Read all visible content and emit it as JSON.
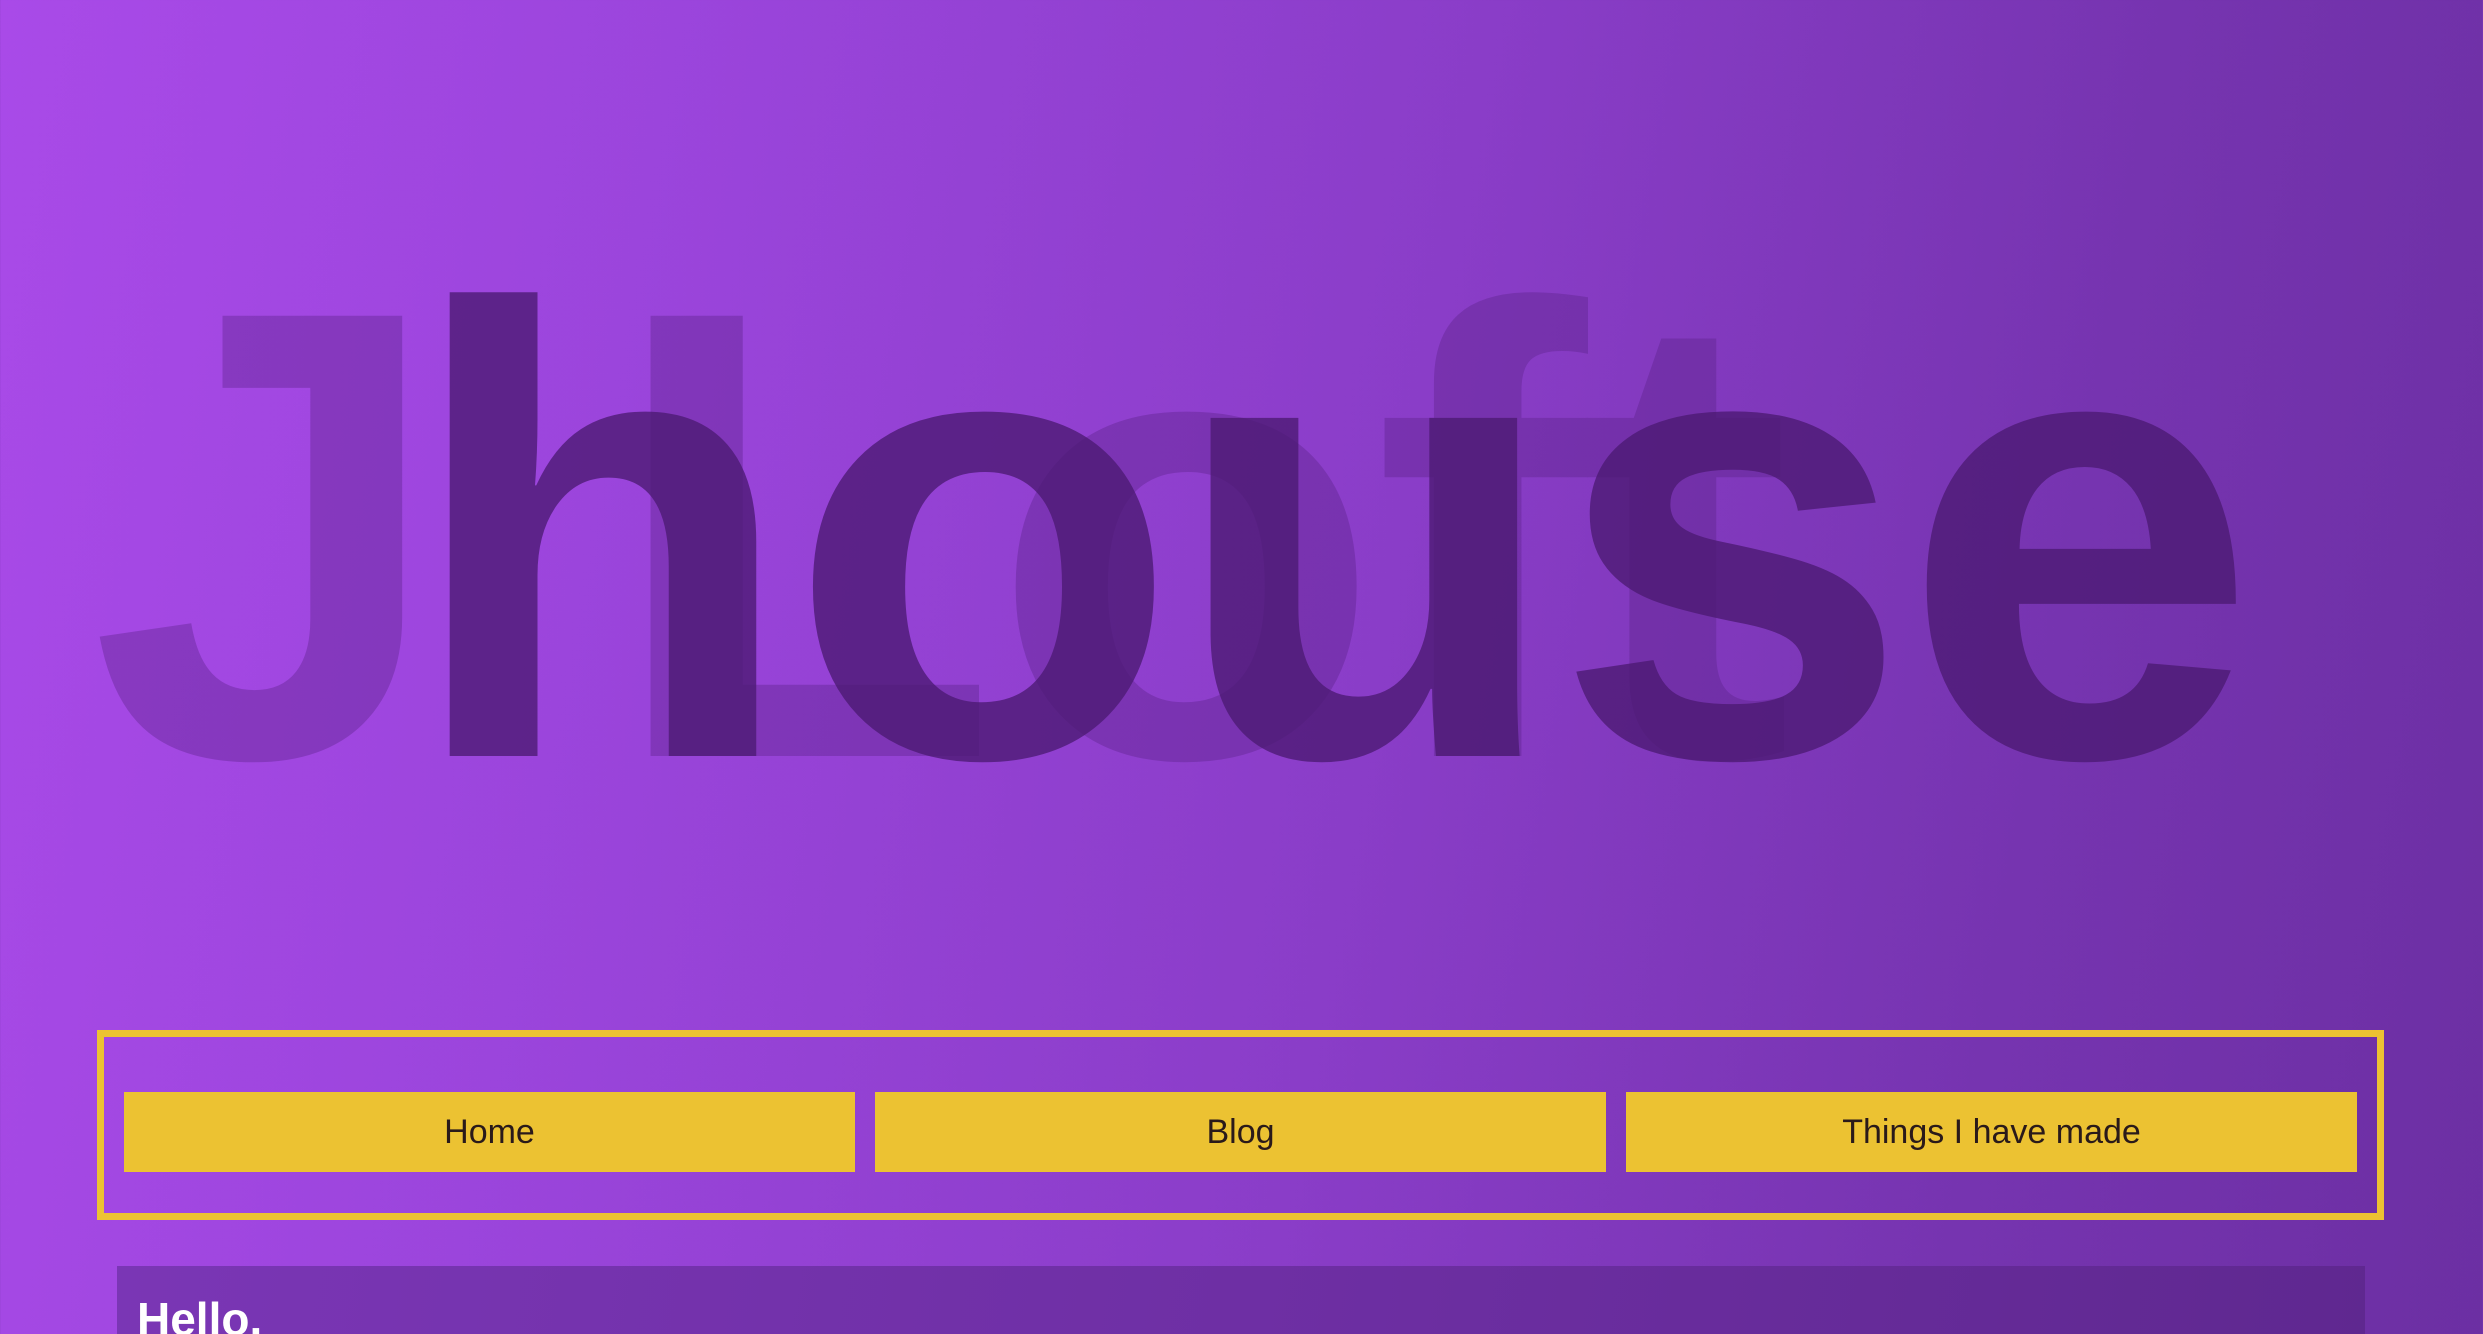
{
  "hero": {
    "logo_back": "J Loft",
    "logo_front": "house"
  },
  "nav": {
    "items": [
      {
        "label": "Home"
      },
      {
        "label": "Blog"
      },
      {
        "label": "Things I have made"
      }
    ]
  },
  "main": {
    "heading": "Hello."
  },
  "colors": {
    "accent": "#ecc232",
    "background_start": "#a94ae8",
    "background_end": "#6c2fa3",
    "panel": "#6e2fa4"
  }
}
